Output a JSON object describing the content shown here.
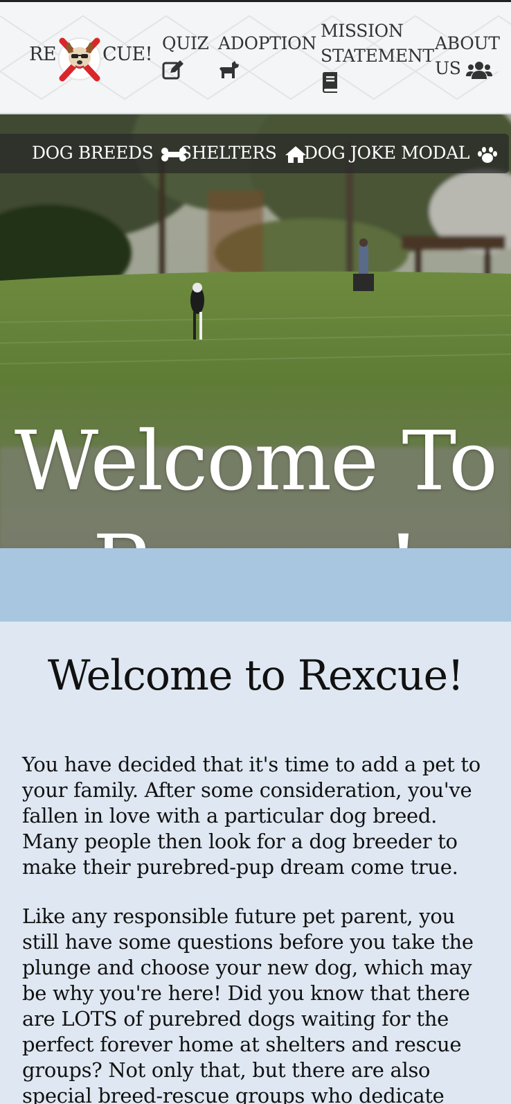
{
  "header": {
    "logo": {
      "left_text": "RE",
      "right_text": "CUE!",
      "badge_icon": "rescue-dog-icon"
    },
    "nav": [
      {
        "label": "QUIZ",
        "icon": "edit-icon"
      },
      {
        "label": "ADOPTION",
        "icon": "dog-icon"
      },
      {
        "label_line1": "MISSION",
        "label_line2": "STATEMENT",
        "icon": "book-icon"
      },
      {
        "label_line1": "ABOUT",
        "label_line2": "US",
        "icon": "users-icon"
      }
    ]
  },
  "subnav": [
    {
      "label": "DOG BREEDS",
      "icon": "bone-icon"
    },
    {
      "label": "SHELTERS",
      "icon": "home-icon"
    },
    {
      "label": "DOG JOKE MODAL",
      "icon": "paw-icon"
    }
  ],
  "hero": {
    "title_line1": "Welcome To",
    "title_line2": "Rexcue!"
  },
  "main": {
    "heading": "Welcome to Rexcue!",
    "paragraphs": [
      "You have decided that it's time to add a pet to your family. After some consideration, you've fallen in love with a particular dog breed. Many people then look for a dog breeder to make their purebred-pup dream come true.",
      "Like any responsible future pet parent, you still have some questions before you take the plunge and choose your new dog, which may be why you're here! Did you know that there are LOTS of purebred dogs waiting for the perfect forever home at shelters and rescue groups? Not only that, but there are also special breed-rescue groups who dedicate their efforts to finding"
    ]
  },
  "colors": {
    "band": "#a9c6e0",
    "content_bg": "#dfe8f2",
    "badge_red": "#d9262a"
  }
}
